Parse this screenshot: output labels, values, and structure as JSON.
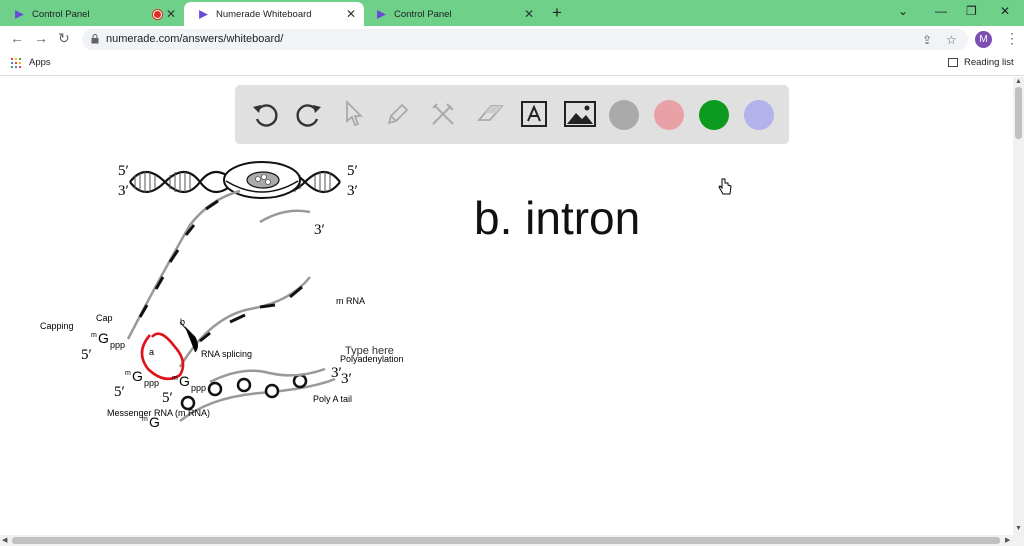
{
  "tabs": [
    {
      "title": "Control Panel",
      "active": false
    },
    {
      "title": "Numerade Whiteboard",
      "active": true
    },
    {
      "title": "Control Panel",
      "active": false
    }
  ],
  "address": {
    "url": "numerade.com/answers/whiteboard/"
  },
  "profile": {
    "initial": "M"
  },
  "bookmarks": {
    "apps": "Apps",
    "reading_list": "Reading list"
  },
  "whiteboard": {
    "tools": [
      "undo-icon",
      "redo-icon",
      "pointer-icon",
      "pen-icon",
      "tools-icon",
      "eraser-icon",
      "text-tool-icon",
      "image-icon"
    ],
    "colors": [
      "#aaaaaa",
      "#e8a2a7",
      "#0c9b1f",
      "#b3b2ea"
    ],
    "answer": "b. intron"
  },
  "diagram": {
    "five_prime": "5′",
    "three_prime": "3′",
    "mrna": "m RNA",
    "capping": "Capping",
    "cap": "Cap",
    "m_sup": "m",
    "g": "G",
    "ppp": "ppp",
    "a": "a",
    "b": "b",
    "rna_splicing": "RNA splicing",
    "type_here": "Type here",
    "polyadenylation": "Polyadenylation",
    "poly_a_tail": "Poly A tail",
    "messenger_rna": "Messenger RNA (m RNA)"
  }
}
